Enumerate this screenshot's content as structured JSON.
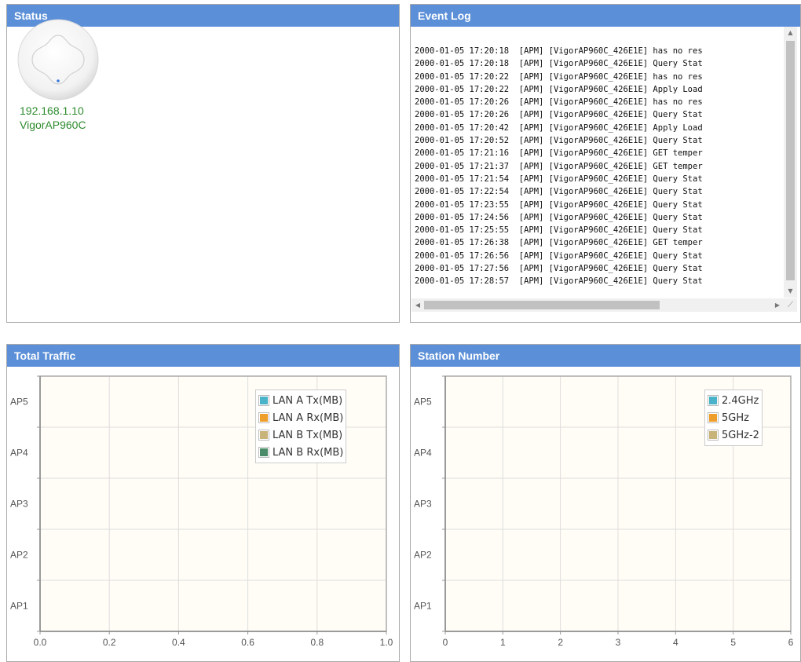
{
  "status": {
    "title": "Status",
    "device_ip": "192.168.1.10",
    "device_name": "VigorAP960C"
  },
  "event_log": {
    "title": "Event Log",
    "lines": [
      "2000-01-05 17:20:18  [APM] [VigorAP960C_426E1E] has no res",
      "2000-01-05 17:20:18  [APM] [VigorAP960C_426E1E] Query Stat",
      "2000-01-05 17:20:22  [APM] [VigorAP960C_426E1E] has no res",
      "2000-01-05 17:20:22  [APM] [VigorAP960C_426E1E] Apply Load",
      "2000-01-05 17:20:26  [APM] [VigorAP960C_426E1E] has no res",
      "2000-01-05 17:20:26  [APM] [VigorAP960C_426E1E] Query Stat",
      "2000-01-05 17:20:42  [APM] [VigorAP960C_426E1E] Apply Load",
      "2000-01-05 17:20:52  [APM] [VigorAP960C_426E1E] Query Stat",
      "2000-01-05 17:21:16  [APM] [VigorAP960C_426E1E] GET temper",
      "2000-01-05 17:21:37  [APM] [VigorAP960C_426E1E] GET temper",
      "2000-01-05 17:21:54  [APM] [VigorAP960C_426E1E] Query Stat",
      "2000-01-05 17:22:54  [APM] [VigorAP960C_426E1E] Query Stat",
      "2000-01-05 17:23:55  [APM] [VigorAP960C_426E1E] Query Stat",
      "2000-01-05 17:24:56  [APM] [VigorAP960C_426E1E] Query Stat",
      "2000-01-05 17:25:55  [APM] [VigorAP960C_426E1E] Query Stat",
      "2000-01-05 17:26:38  [APM] [VigorAP960C_426E1E] GET temper",
      "2000-01-05 17:26:56  [APM] [VigorAP960C_426E1E] Query Stat",
      "2000-01-05 17:27:56  [APM] [VigorAP960C_426E1E] Query Stat",
      "2000-01-05 17:28:57  [APM] [VigorAP960C_426E1E] Query Stat"
    ]
  },
  "total_traffic": {
    "title": "Total Traffic",
    "legend": [
      {
        "label": "LAN A Tx(MB)",
        "color": "#4bb3c9"
      },
      {
        "label": "LAN A Rx(MB)",
        "color": "#ee9e2a"
      },
      {
        "label": "LAN B Tx(MB)",
        "color": "#c8b479"
      },
      {
        "label": "LAN B Rx(MB)",
        "color": "#4a8c6a"
      }
    ]
  },
  "station_number": {
    "title": "Station Number",
    "legend": [
      {
        "label": "2.4GHz",
        "color": "#4bb3c9"
      },
      {
        "label": "5GHz",
        "color": "#ee9e2a"
      },
      {
        "label": "5GHz-2",
        "color": "#c8b479"
      }
    ]
  },
  "chart_data": [
    {
      "type": "bar",
      "title": "Total Traffic",
      "orientation": "horizontal",
      "categories": [
        "AP5",
        "AP4",
        "AP3",
        "AP2",
        "AP1"
      ],
      "xticks": [
        "0.0",
        "0.2",
        "0.4",
        "0.6",
        "0.8",
        "1.0"
      ],
      "xlim": [
        0,
        1.0
      ],
      "grid": true,
      "legend_position": "top-right",
      "series": [
        {
          "name": "LAN A Tx(MB)",
          "values": [
            0,
            0,
            0,
            0,
            0
          ]
        },
        {
          "name": "LAN A Rx(MB)",
          "values": [
            0,
            0,
            0,
            0,
            0
          ]
        },
        {
          "name": "LAN B Tx(MB)",
          "values": [
            0,
            0,
            0,
            0,
            0
          ]
        },
        {
          "name": "LAN B Rx(MB)",
          "values": [
            0,
            0,
            0,
            0,
            0
          ]
        }
      ]
    },
    {
      "type": "bar",
      "title": "Station Number",
      "orientation": "horizontal",
      "categories": [
        "AP5",
        "AP4",
        "AP3",
        "AP2",
        "AP1"
      ],
      "xticks": [
        "0",
        "1",
        "2",
        "3",
        "4",
        "5",
        "6"
      ],
      "xlim": [
        0,
        6
      ],
      "grid": true,
      "legend_position": "top-right",
      "series": [
        {
          "name": "2.4GHz",
          "values": [
            0,
            0,
            0,
            0,
            0
          ]
        },
        {
          "name": "5GHz",
          "values": [
            0,
            0,
            0,
            0,
            0
          ]
        },
        {
          "name": "5GHz-2",
          "values": [
            0,
            0,
            0,
            0,
            0
          ]
        }
      ]
    }
  ]
}
